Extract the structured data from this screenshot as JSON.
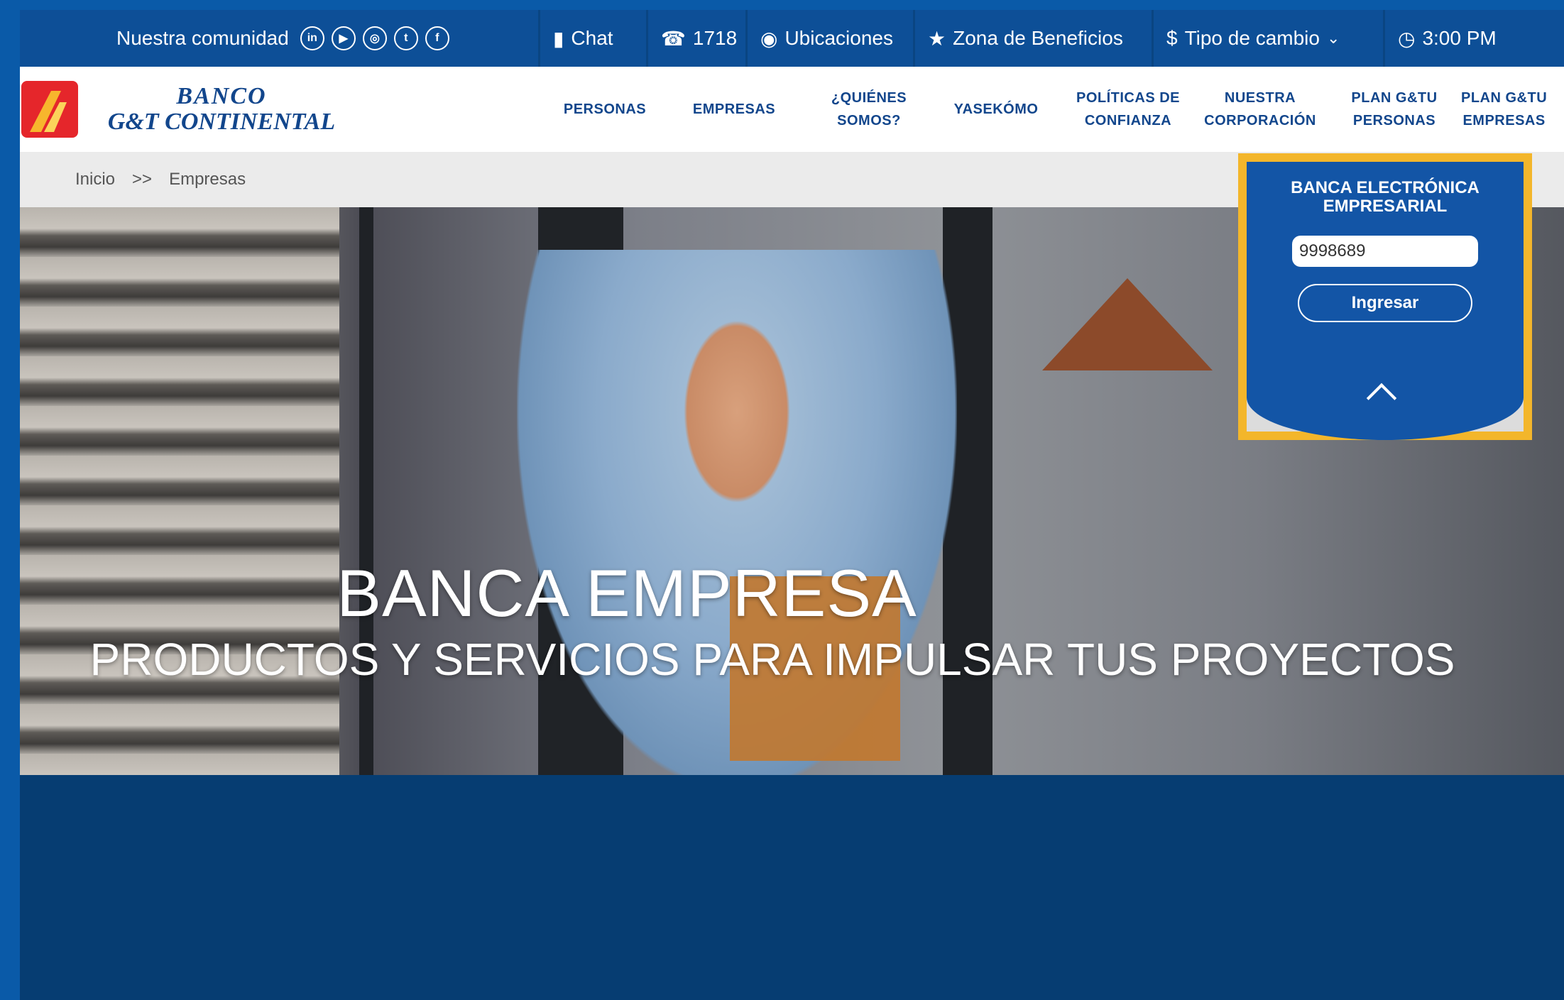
{
  "topbar": {
    "community_label": "Nuestra comunidad",
    "social": [
      {
        "icon": "linkedin-icon",
        "glyph": "in"
      },
      {
        "icon": "youtube-icon",
        "glyph": "▶"
      },
      {
        "icon": "instagram-icon",
        "glyph": "◎"
      },
      {
        "icon": "twitter-icon",
        "glyph": "t"
      },
      {
        "icon": "facebook-icon",
        "glyph": "f"
      }
    ],
    "chat": "Chat",
    "phone": "1718",
    "locations": "Ubicaciones",
    "benefits": "Zona de Beneficios",
    "exchange": "Tipo de cambio",
    "time": "3:00 PM"
  },
  "brand": {
    "line1": "BANCO",
    "line2": "G&T CONTINENTAL"
  },
  "nav": {
    "items": [
      {
        "label": "PERSONAS"
      },
      {
        "label": "EMPRESAS"
      },
      {
        "label1": "¿QUIÉNES",
        "label2": "SOMOS?"
      },
      {
        "label": "YASEKÓMO"
      },
      {
        "label1": "POLÍTICAS DE",
        "label2": "CONFIANZA"
      },
      {
        "label1": "NUESTRA",
        "label2": "CORPORACIÓN"
      },
      {
        "label1": "PLAN G&TU",
        "label2": "PERSONAS"
      },
      {
        "label1": "PLAN G&TU",
        "label2": "EMPRESAS"
      }
    ]
  },
  "breadcrumb": {
    "home": "Inicio",
    "separator": ">>",
    "current": "Empresas"
  },
  "hero": {
    "title": "BANCA EMPRESA",
    "subtitle": "PRODUCTOS Y SERVICIOS PARA IMPULSAR TUS PROYECTOS"
  },
  "login": {
    "title_line1": "BANCA ELECTRÓNICA",
    "title_line2": "EMPRESARIAL",
    "user_value": "9998689",
    "button": "Ingresar"
  },
  "colors": {
    "brand_blue": "#12468c",
    "topbar": "#0d4f97",
    "highlight": "#f3b62b",
    "logo_red": "#e5262b"
  }
}
